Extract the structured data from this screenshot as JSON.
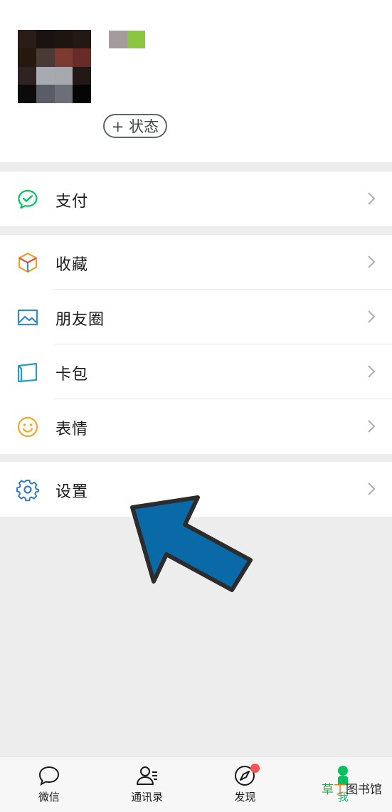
{
  "profile": {
    "status_button": "+ 状态",
    "avatar_pixels": [
      "#2a1c17",
      "#1a1311",
      "#1e1511",
      "#231813",
      "#26180f",
      "#4a3a36",
      "#7c3a30",
      "#6a2a28",
      "#2e2222",
      "#a8aab2",
      "#a7a8ae",
      "#221816",
      "#0c0a0a",
      "#5a5c66",
      "#6c6e78",
      "#050505"
    ]
  },
  "menu": {
    "pay": "支付",
    "favorites": "收藏",
    "moments": "朋友圈",
    "cards": "卡包",
    "stickers": "表情",
    "settings": "设置"
  },
  "tabs": [
    {
      "label": "微信",
      "icon": "chat-bubble-icon"
    },
    {
      "label": "通讯录",
      "icon": "contacts-icon"
    },
    {
      "label": "发现",
      "icon": "compass-icon"
    },
    {
      "label": "我",
      "icon": "me-icon"
    }
  ],
  "watermark": {
    "green": "草",
    "orange": "丁",
    "rest": "图书馆"
  },
  "colors": {
    "accent": "#07c160",
    "arrow": "#0a6aa8",
    "badge": "#fa5151"
  }
}
